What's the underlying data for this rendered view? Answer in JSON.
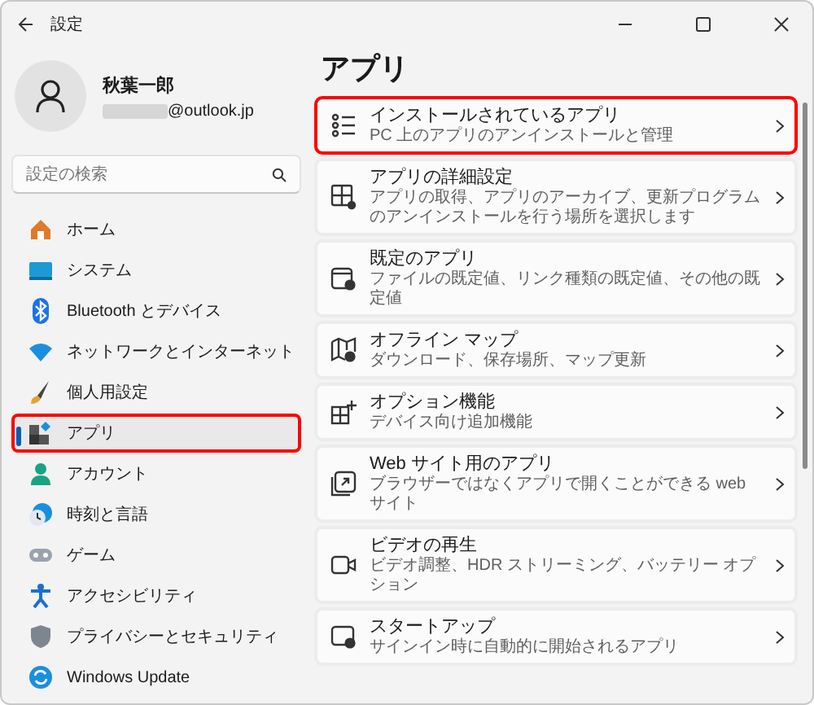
{
  "window": {
    "title": "設定"
  },
  "profile": {
    "name": "秋葉一郎",
    "email": "@outlook.jp"
  },
  "search": {
    "placeholder": "設定の検索"
  },
  "sidebar": {
    "items": [
      {
        "label": "ホーム",
        "selected": false,
        "highlighted": false
      },
      {
        "label": "システム",
        "selected": false,
        "highlighted": false
      },
      {
        "label": "Bluetooth とデバイス",
        "selected": false,
        "highlighted": false
      },
      {
        "label": "ネットワークとインターネット",
        "selected": false,
        "highlighted": false
      },
      {
        "label": "個人用設定",
        "selected": false,
        "highlighted": false
      },
      {
        "label": "アプリ",
        "selected": true,
        "highlighted": true
      },
      {
        "label": "アカウント",
        "selected": false,
        "highlighted": false
      },
      {
        "label": "時刻と言語",
        "selected": false,
        "highlighted": false
      },
      {
        "label": "ゲーム",
        "selected": false,
        "highlighted": false
      },
      {
        "label": "アクセシビリティ",
        "selected": false,
        "highlighted": false
      },
      {
        "label": "プライバシーとセキュリティ",
        "selected": false,
        "highlighted": false
      },
      {
        "label": "Windows Update",
        "selected": false,
        "highlighted": false
      }
    ]
  },
  "page": {
    "title": "アプリ",
    "cards": [
      {
        "title": "インストールされているアプリ",
        "description": "PC 上のアプリのアンインストールと管理",
        "highlighted": true
      },
      {
        "title": "アプリの詳細設定",
        "description": "アプリの取得、アプリのアーカイブ、更新プログラムのアンインストールを行う場所を選択します",
        "highlighted": false
      },
      {
        "title": "既定のアプリ",
        "description": "ファイルの既定値、リンク種類の既定値、その他の既定値",
        "highlighted": false
      },
      {
        "title": "オフライン マップ",
        "description": "ダウンロード、保存場所、マップ更新",
        "highlighted": false
      },
      {
        "title": "オプション機能",
        "description": "デバイス向け追加機能",
        "highlighted": false
      },
      {
        "title": "Web サイト用のアプリ",
        "description": "ブラウザーではなくアプリで開くことができる web サイト",
        "highlighted": false
      },
      {
        "title": "ビデオの再生",
        "description": "ビデオ調整、HDR ストリーミング、バッテリー オプション",
        "highlighted": false
      },
      {
        "title": "スタートアップ",
        "description": "サインイン時に自動的に開始されるアプリ",
        "highlighted": false
      }
    ]
  }
}
